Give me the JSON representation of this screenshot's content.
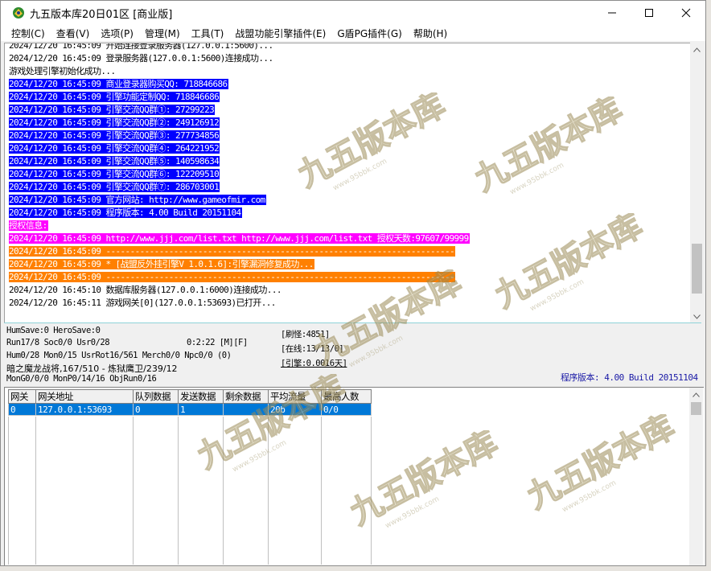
{
  "window": {
    "title": "九五版本库20日01区 [商业版]",
    "minimize_glyph": "—",
    "maximize_glyph": "☐",
    "close_glyph": "✕"
  },
  "menu": [
    {
      "label": "控制(C)"
    },
    {
      "label": "查看(V)"
    },
    {
      "label": "选项(P)"
    },
    {
      "label": "管理(M)"
    },
    {
      "label": "工具(T)"
    },
    {
      "label": "战盟功能引擎插件(E)"
    },
    {
      "label": "G盾PG插件(G)"
    },
    {
      "label": "帮助(H)"
    }
  ],
  "log": {
    "lines": [
      {
        "text": "2024/12/20 16:45:09 开始连接登录服务器(127.0.0.1:5600)...",
        "style": "normal"
      },
      {
        "text": "2024/12/20 16:45:09 登录服务器(127.0.0.1:5600)连接成功...",
        "style": "normal"
      },
      {
        "text": "游戏处理引擎初始化成功...",
        "style": "normal"
      },
      {
        "text": "2024/12/20 16:45:09 商业登录器购买QQ: 718846686",
        "style": "blue"
      },
      {
        "text": "2024/12/20 16:45:09 引擎功能定制QQ: 718846686",
        "style": "blue"
      },
      {
        "text": "2024/12/20 16:45:09 引擎交流QQ群①: 27299223",
        "style": "blue"
      },
      {
        "text": "2024/12/20 16:45:09 引擎交流QQ群②: 249126912",
        "style": "blue"
      },
      {
        "text": "2024/12/20 16:45:09 引擎交流QQ群③: 277734856",
        "style": "blue"
      },
      {
        "text": "2024/12/20 16:45:09 引擎交流QQ群④: 264221952",
        "style": "blue"
      },
      {
        "text": "2024/12/20 16:45:09 引擎交流QQ群⑤: 140598634",
        "style": "blue"
      },
      {
        "text": "2024/12/20 16:45:09 引擎交流QQ群⑥: 122209510",
        "style": "blue"
      },
      {
        "text": "2024/12/20 16:45:09 引擎交流QQ群⑦: 286703001",
        "style": "blue"
      },
      {
        "text": "2024/12/20 16:45:09 官方网站: http://www.gameofmir.com",
        "style": "blue"
      },
      {
        "text": "2024/12/20 16:45:09 程序版本: 4.00 Build 20151104",
        "style": "blue"
      },
      {
        "text": "授权信息:",
        "style": "magenta"
      },
      {
        "text": "2024/12/20 16:45:09 http://www.jjj.com/list.txt http://www.jjj.com/list.txt 授权天数:97607/99999",
        "style": "magenta"
      },
      {
        "text": "2024/12/20 16:45:09 ------------------------------------------------------------------------",
        "style": "orange"
      },
      {
        "text": "2024/12/20 16:45:09 * [战盟反外挂引擎V 1.0.1.6]:引擎漏洞修复成功...",
        "style": "orange"
      },
      {
        "text": "2024/12/20 16:45:09 ------------------------------------------------------------------------",
        "style": "orange"
      },
      {
        "text": "2024/12/20 16:45:10 数据库服务器(127.0.0.1:6000)连接成功...",
        "style": "normal"
      },
      {
        "text": "2024/12/20 16:45:11 游戏网关[0](127.0.0.1:53693)已打开...",
        "style": "normal"
      }
    ]
  },
  "status": {
    "hum_save": "HumSave:0 HeroSave:0",
    "run": "Run17/8 Soc0/0 Usr0/28",
    "time": "0:2:22 [M][F]",
    "hum": "Hum0/28 Mon0/15 UsrRot16/561 Merch0/0 Npc0/0 (0)",
    "boss": "暗之魔龙战将,167/510 - 炼狱鹰卫/239/12",
    "mon": "MonG0/0/0 MonP0/14/16 ObjRun0/16",
    "refresh": "[刷怪:4851]",
    "online": "[在线:13/13/0]",
    "engine": "[引擎:0.0016天]",
    "version": "程序版本: 4.00 Build 20151104"
  },
  "grid": {
    "headers": [
      "网关",
      "网关地址",
      "队列数据",
      "发送数据",
      "剩余数据",
      "平均流量",
      "最高人数"
    ],
    "rows": [
      [
        "0",
        "127.0.0.1:53693",
        "0",
        "1",
        "",
        "20b",
        "0/0"
      ]
    ]
  },
  "watermark": {
    "text": "九五版本库",
    "url": "www.95bbk.com"
  },
  "colors": {
    "blue_highlight": "#0000ff",
    "magenta_highlight": "#ff00ff",
    "orange_highlight": "#ff8000",
    "selection": "#0078d7"
  }
}
